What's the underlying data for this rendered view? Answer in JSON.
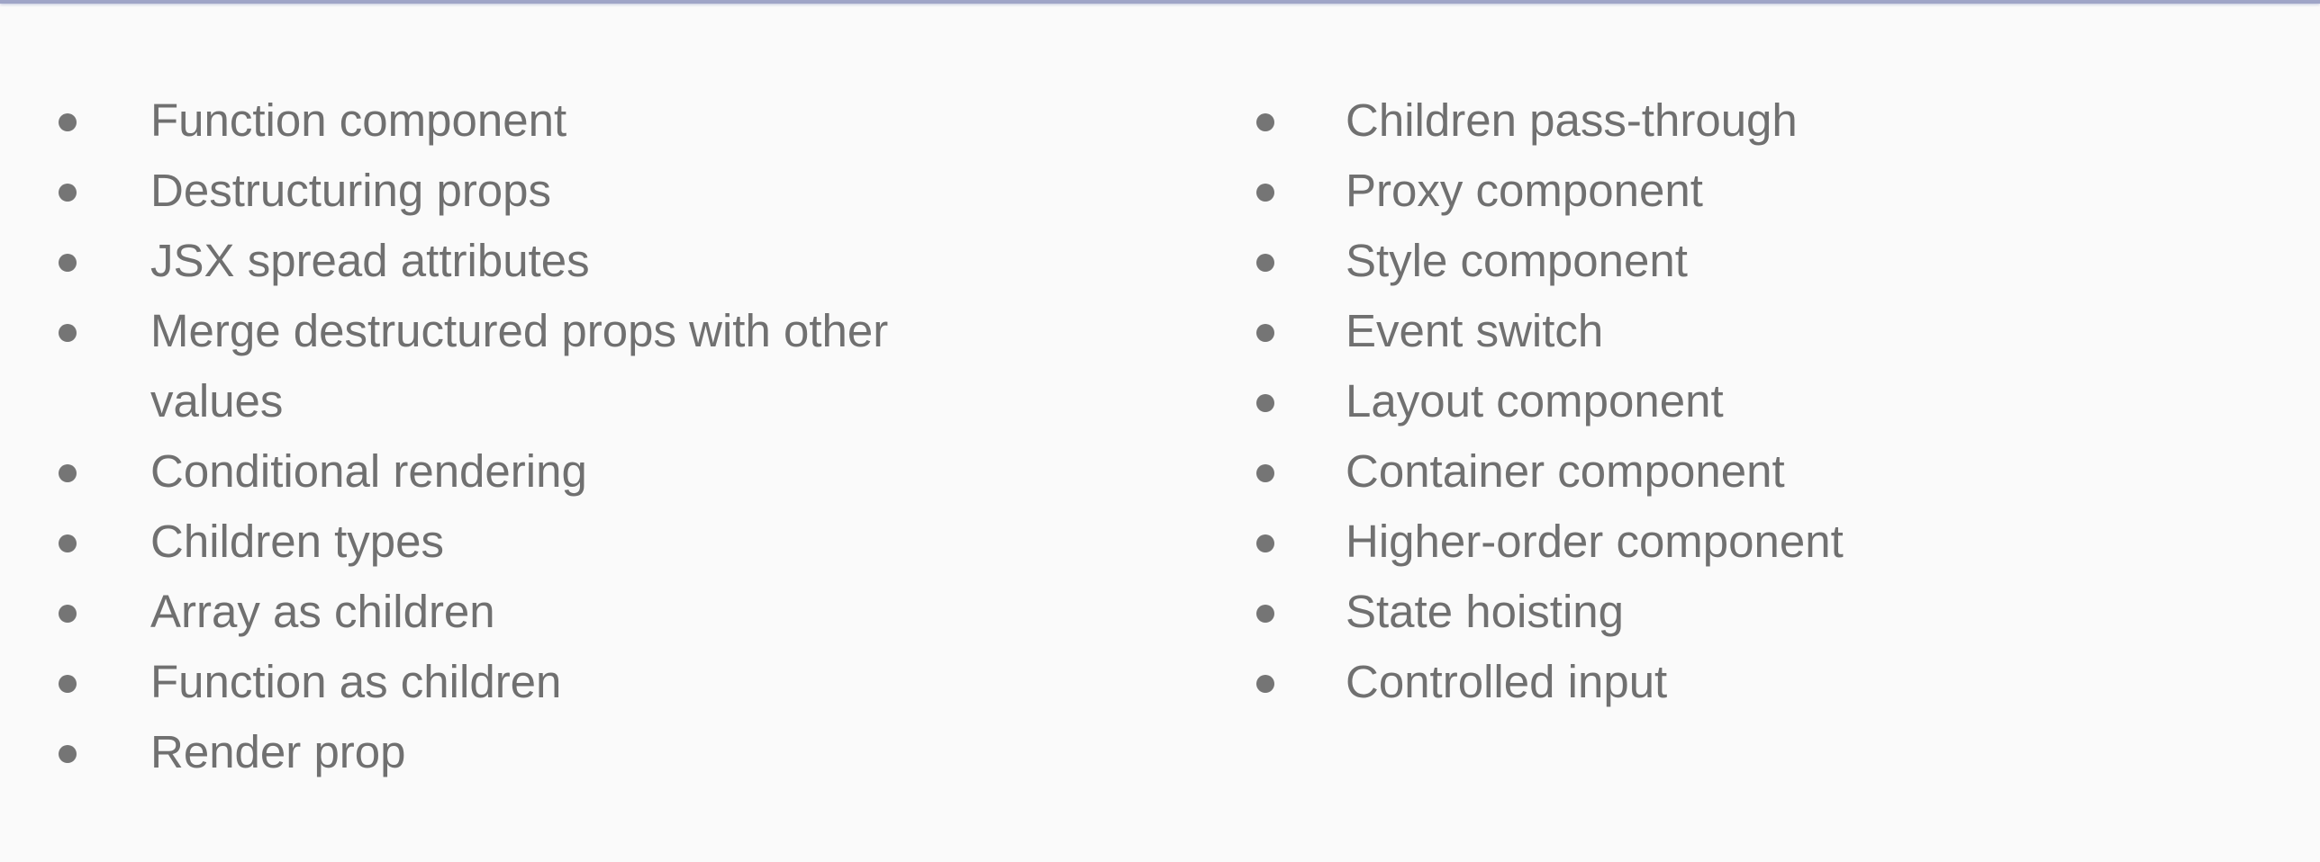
{
  "list": {
    "left": [
      "Function component",
      "Destructuring props",
      "JSX spread attributes",
      "Merge destructured props with other values",
      "Conditional rendering",
      "Children types",
      "Array as children",
      "Function as children",
      "Render prop"
    ],
    "right": [
      "Children pass-through",
      "Proxy component",
      "Style component",
      "Event switch",
      "Layout component",
      "Container component",
      "Higher-order component",
      "State hoisting",
      "Controlled input"
    ]
  },
  "colors": {
    "background": "#fafafa",
    "text": "#707070",
    "bullet": "#757575",
    "top_border": "#9fa5c7"
  }
}
